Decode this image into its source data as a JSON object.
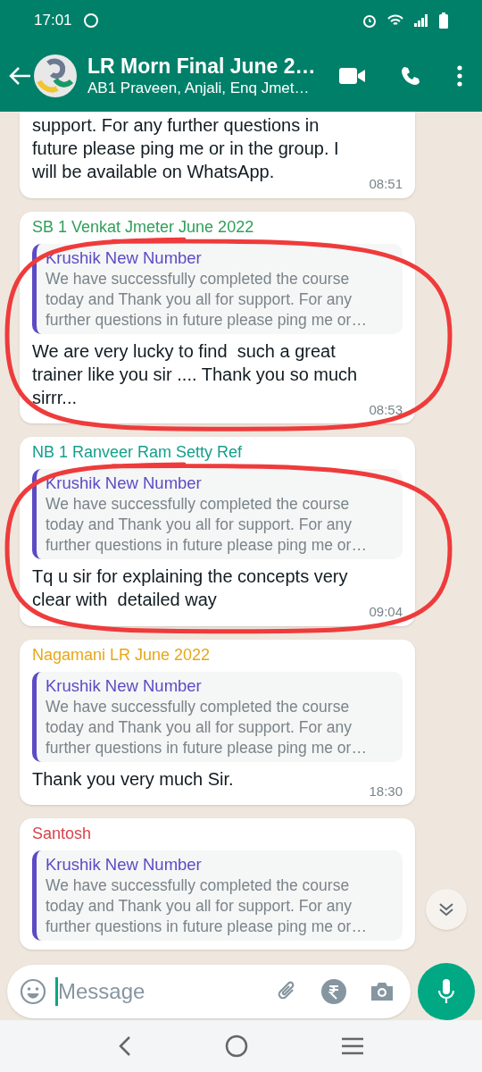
{
  "status_bar": {
    "time": "17:01"
  },
  "header": {
    "title": "LR Morn Final June 2…",
    "subtitle": "AB1 Praveen, Anjali, Enq Jmet…"
  },
  "messages": [
    {
      "text": "support. For any further questions in future please ping me or in the group. I will be available on WhatsApp.",
      "time": "08:51"
    },
    {
      "sender": "SB 1 Venkat Jmeter June 2022",
      "color": "#2fa05a",
      "quote": {
        "author": "Krushik New Number",
        "text": "We have successfully completed the course today and Thank you all for support. For any further questions in future please ping me or…"
      },
      "text": "We are very lucky to find  such a great trainer like you sir .... Thank you so much sirrr...",
      "time": "08:53",
      "annotated": true
    },
    {
      "sender": "NB 1 Ranveer Ram Setty Ref",
      "color": "#13a08c",
      "quote": {
        "author": "Krushik New Number",
        "text": "We have successfully completed the course today and Thank you all for support. For any further questions in future please ping me or…"
      },
      "text": "Tq u sir for explaining the concepts very clear with  detailed way",
      "time": "09:04",
      "annotated": true
    },
    {
      "sender": "Nagamani LR June 2022",
      "color": "#e6a817",
      "quote": {
        "author": "Krushik New Number",
        "text": "We have successfully completed the course today and Thank you all for support. For any further questions in future please ping me or…"
      },
      "text": "Thank you very much Sir.",
      "time": "18:30",
      "annotated": false
    },
    {
      "sender": "Santosh",
      "color": "#d9434b",
      "quote": {
        "author": "Krushik New Number",
        "text": "We have successfully completed the course today and Thank you all for support. For any further questions in future please ping me or…"
      },
      "annotated": false
    }
  ],
  "composer": {
    "placeholder": "Message"
  }
}
